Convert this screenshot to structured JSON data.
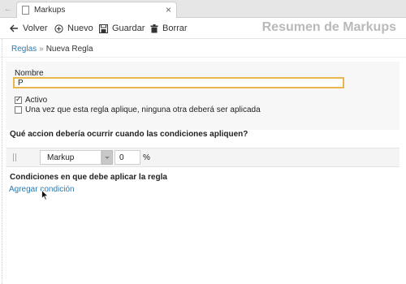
{
  "browser": {
    "tab_title": "Markups",
    "close_glyph": "×",
    "back_glyph": "←"
  },
  "toolbar": {
    "back_label": "Volver",
    "new_label": "Nuevo",
    "save_label": "Guardar",
    "delete_label": "Borrar",
    "page_heading": "Resumen de Markups"
  },
  "breadcrumb": {
    "parent": "Reglas",
    "separator": "»",
    "current": "Nueva Regla"
  },
  "form": {
    "name_label": "Nombre",
    "name_value": "P",
    "active_label": "Activo",
    "active_checked": true,
    "exclusive_label": "Una vez que esta regla aplique, ninguna otra deberá ser aplicada",
    "exclusive_checked": false
  },
  "action_section": {
    "title": "Qué accion debería ocurrir cuando las condiciones apliquen?",
    "action_type": "Markup",
    "amount": "0",
    "unit": "%"
  },
  "conditions_section": {
    "title": "Condiciones en que debe aplicar la regla",
    "add_link": "Agregar condición"
  },
  "colors": {
    "accent_link": "#2a7ab0",
    "focus_border": "#e8b64a",
    "heading_gray": "#b9b9b9"
  },
  "icons": [
    "back-arrow-icon",
    "plus-circle-icon",
    "save-disk-icon",
    "trash-icon",
    "page-icon",
    "close-icon",
    "mouse-cursor-icon"
  ]
}
